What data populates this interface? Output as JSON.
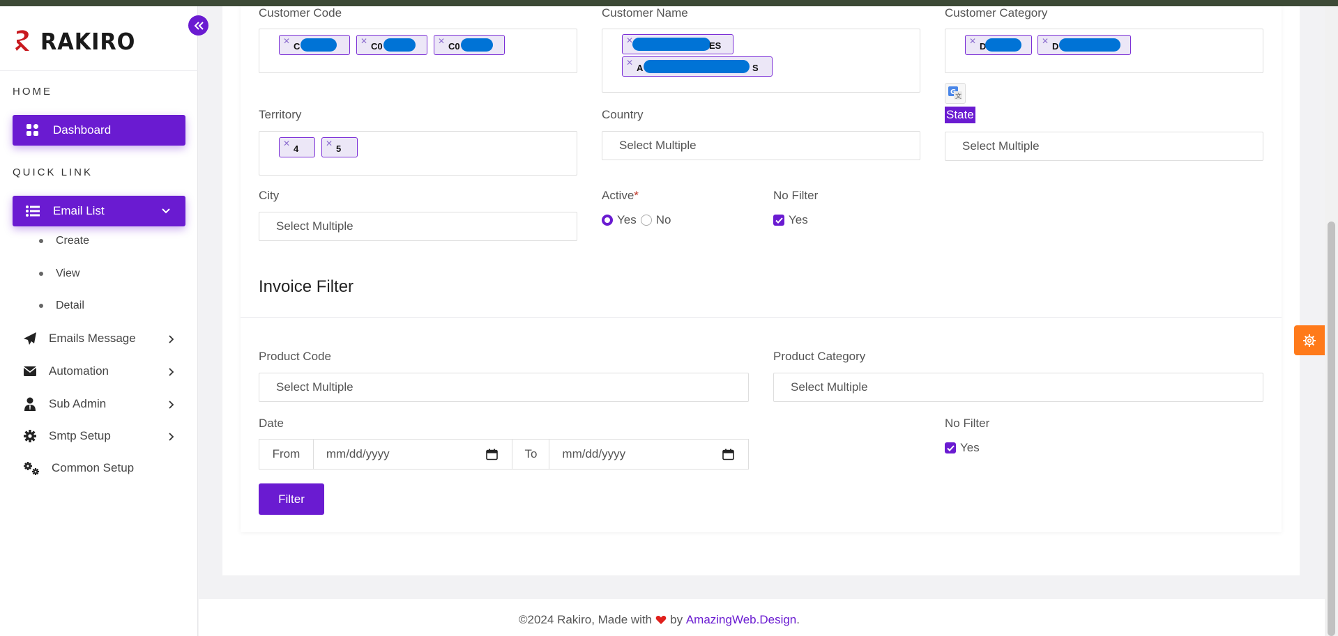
{
  "brand": {
    "name": "RAKIRO"
  },
  "sidebar": {
    "home_title": "HOME",
    "dashboard_label": "Dashboard",
    "quick_link_title": "QUICK LINK",
    "email_list_label": "Email List",
    "email_list_sub": [
      "Create",
      "View",
      "Detail"
    ],
    "items": [
      {
        "label": "Emails Message",
        "icon": "paper-plane-icon"
      },
      {
        "label": "Automation",
        "icon": "envelope-icon"
      },
      {
        "label": "Sub Admin",
        "icon": "user-icon"
      },
      {
        "label": "Smtp Setup",
        "icon": "gear-icon"
      },
      {
        "label": "Common Setup",
        "icon": "gears-icon"
      }
    ]
  },
  "customer_filter": {
    "customer_code": {
      "label": "Customer Code",
      "tags": [
        "C",
        "C0",
        "C0"
      ]
    },
    "customer_name": {
      "label": "Customer Name",
      "tags": [
        "ES",
        "A",
        "S"
      ]
    },
    "customer_category": {
      "label": "Customer Category",
      "tags": [
        "D",
        "D"
      ]
    },
    "territory": {
      "label": "Territory",
      "tags": [
        "4",
        "5"
      ]
    },
    "country": {
      "label": "Country",
      "placeholder": "Select Multiple"
    },
    "state": {
      "label": "State",
      "placeholder": "Select Multiple"
    },
    "city": {
      "label": "City",
      "placeholder": "Select Multiple"
    },
    "active": {
      "label": "Active",
      "required_mark": "*",
      "yes": "Yes",
      "no": "No",
      "selected": "Yes"
    },
    "no_filter": {
      "label": "No Filter",
      "option": "Yes",
      "checked": true
    }
  },
  "invoice_filter": {
    "heading": "Invoice Filter",
    "product_code": {
      "label": "Product Code",
      "placeholder": "Select Multiple"
    },
    "product_category": {
      "label": "Product Category",
      "placeholder": "Select Multiple"
    },
    "date": {
      "label": "Date",
      "from": "From",
      "to": "To",
      "from_placeholder": "mm/dd/yyyy",
      "to_placeholder": "mm/dd/yyyy"
    },
    "no_filter": {
      "label": "No Filter",
      "option": "Yes",
      "checked": true
    },
    "filter_button": "Filter"
  },
  "footer": {
    "text": "©2024 Rakiro, Made with",
    "by": "by",
    "link": "AmazingWeb.Design",
    "end": "."
  },
  "colors": {
    "accent": "#6a1bd1",
    "orange": "#ff7a1a",
    "tag_bg": "#ece7f7",
    "redaction": "#0073d6"
  }
}
